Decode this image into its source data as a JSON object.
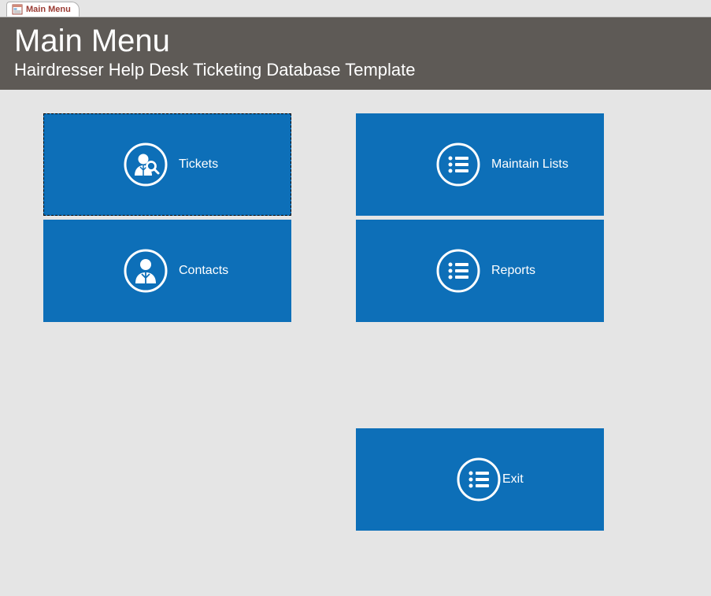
{
  "tab": {
    "label": "Main Menu"
  },
  "header": {
    "title": "Main Menu",
    "subtitle": "Hairdresser Help Desk Ticketing Database Template"
  },
  "tiles": {
    "tickets": {
      "label": "Tickets"
    },
    "contacts": {
      "label": "Contacts"
    },
    "maintain_lists": {
      "label": "Maintain Lists"
    },
    "reports": {
      "label": "Reports"
    },
    "exit": {
      "label": "Exit"
    }
  },
  "colors": {
    "tile_bg": "#0d6fb8",
    "header_bg": "#5e5a56"
  }
}
